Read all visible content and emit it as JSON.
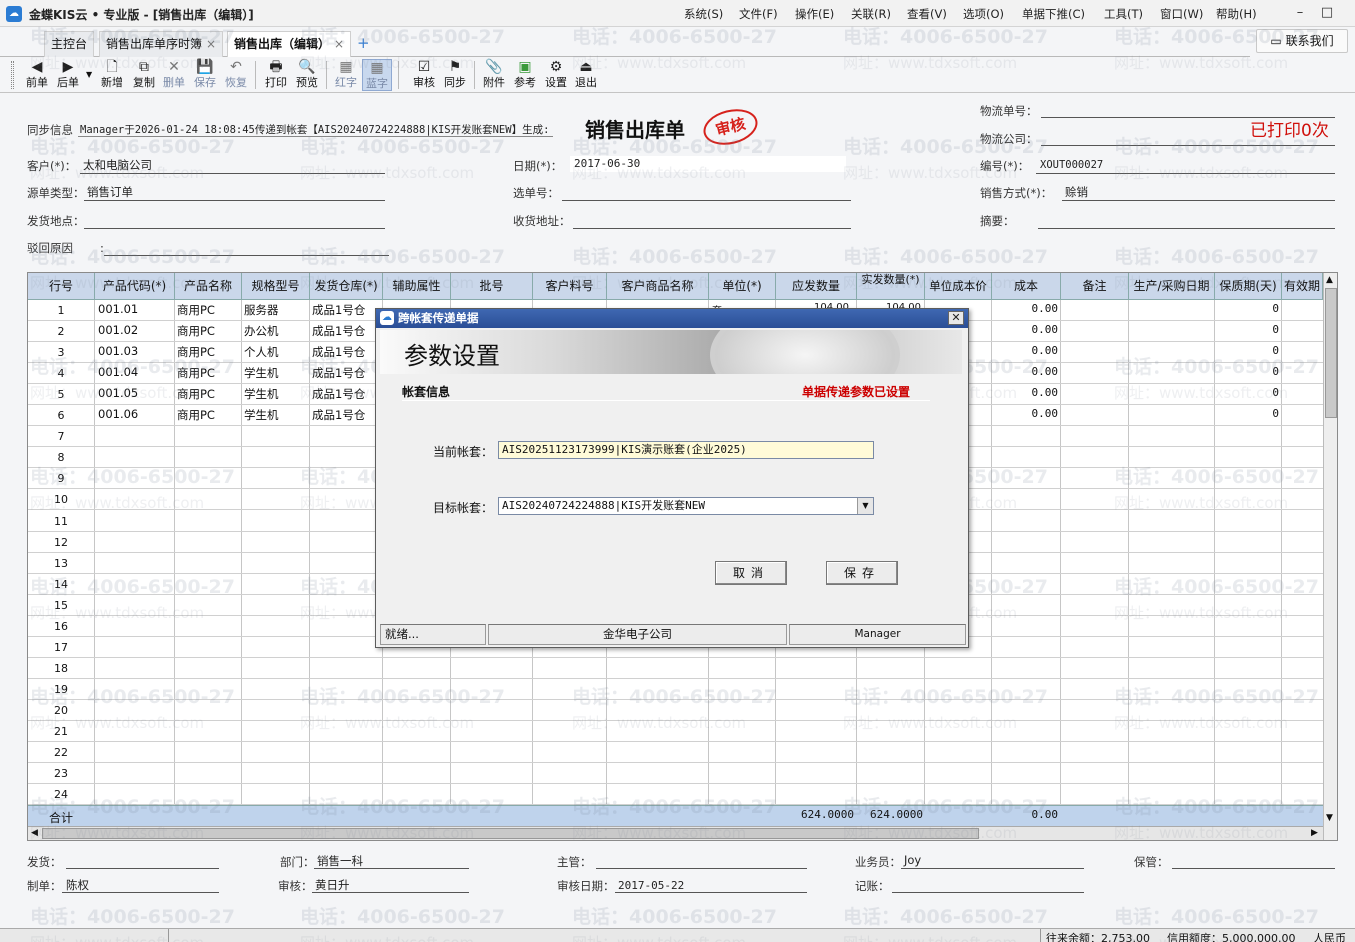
{
  "app": {
    "title": "金蝶KIS云 • 专业版 - [销售出库（编辑）]",
    "logo_color": "#2b7cd3"
  },
  "menu": [
    "系统(S)",
    "文件(F)",
    "操作(E)",
    "关联(R)",
    "查看(V)",
    "选项(O)",
    "单据下推(C)",
    "工具(T)",
    "窗口(W)",
    "帮助(H)"
  ],
  "window_controls": {
    "minimize": "–",
    "restore": "□",
    "close": "✕"
  },
  "contact_button": "联系我们",
  "tabs": {
    "home": "主控台",
    "t1": "销售出库单序时簿",
    "t2": "销售出库（编辑）",
    "add": "+",
    "close": "×"
  },
  "toolbar": {
    "prev": "前单",
    "next": "后单",
    "new": "新增",
    "copy": "复制",
    "delete": "删单",
    "save": "保存",
    "restore": "恢复",
    "print": "打印",
    "preview": "预览",
    "red": "红字",
    "blue": "蓝字",
    "audit": "审核",
    "sync": "同步",
    "attach": "附件",
    "ref": "参考",
    "settings": "设置",
    "exit": "退出"
  },
  "header": {
    "sync_info_label": "同步信息",
    "sync_info_value": "Manager于2026-01-24 18:08:45传递到帐套【AIS20240724224888|KIS开发账套NEW】生成:",
    "doc_title": "销售出库单",
    "stamp": "审核",
    "printed": "已打印0次",
    "customer_label": "客户(*)：",
    "customer": "太和电脑公司",
    "date_label": "日期(*)：",
    "date": "2017-06-30",
    "number_label": "编号(*)：",
    "number": "XOUT000027",
    "source_label": "源单类型：",
    "source": "销售订单",
    "select_label": "选单号：",
    "select": "",
    "sale_method_label": "销售方式(*)：",
    "sale_method": "赊销",
    "ship_place_label": "发货地点：",
    "ship_place": "",
    "recv_addr_label": "收货地址：",
    "recv_addr": "",
    "summary_label": "摘要：",
    "summary": "",
    "reject_label": "驳回原因",
    "reject_colon": ":",
    "reject": "",
    "logistics_no_label": "物流单号：",
    "logistics_no": "",
    "logistics_co_label": "物流公司：",
    "logistics_co": ""
  },
  "grid": {
    "columns": [
      "行号",
      "产品代码(*)",
      "产品名称",
      "规格型号",
      "发货仓库(*)",
      "辅助属性",
      "批号",
      "客户料号",
      "客户商品名称",
      "单位(*)",
      "应发数量",
      "实发数量(*)",
      "单位成本价",
      "成本",
      "备注",
      "生产/采购日期",
      "保质期(天)",
      "有效期"
    ],
    "rows": [
      {
        "no": "1",
        "code": "001.01",
        "name": "商用PC",
        "spec": "服务器",
        "wh": "成品1号仓",
        "cost": "0.00",
        "shelf": "0"
      },
      {
        "no": "2",
        "code": "001.02",
        "name": "商用PC",
        "spec": "办公机",
        "wh": "成品1号仓",
        "cost": "0.00",
        "shelf": "0"
      },
      {
        "no": "3",
        "code": "001.03",
        "name": "商用PC",
        "spec": "个人机",
        "wh": "成品1号仓",
        "cost": "0.00",
        "shelf": "0"
      },
      {
        "no": "4",
        "code": "001.04",
        "name": "商用PC",
        "spec": "学生机",
        "wh": "成品1号仓",
        "cost": "0.00",
        "shelf": "0"
      },
      {
        "no": "5",
        "code": "001.05",
        "name": "商用PC",
        "spec": "学生机",
        "wh": "成品1号仓",
        "cost": "0.00",
        "shelf": "0"
      },
      {
        "no": "6",
        "code": "001.06",
        "name": "商用PC",
        "spec": "学生机",
        "wh": "成品1号仓",
        "cost": "0.00",
        "shelf": "0"
      }
    ],
    "empty_rows": [
      "7",
      "8",
      "9",
      "10",
      "11",
      "12",
      "13",
      "14",
      "15",
      "16",
      "17",
      "18",
      "19",
      "20",
      "21",
      "22",
      "23",
      "24"
    ],
    "total_label": "合计",
    "total_due": "624.0000",
    "total_actual": "624.0000",
    "total_cost": "0.00",
    "row1_unit_partial": "套",
    "row1_due_partial": "104.00",
    "row1_actual_partial": "104.00"
  },
  "footer": {
    "ship_label": "发货：",
    "ship": "",
    "dept_label": "部门：",
    "dept": "销售一科",
    "manager_label": "主管：",
    "manager": "",
    "salesman_label": "业务员：",
    "salesman": "Joy",
    "keeper_label": "保管：",
    "keeper": "",
    "maker_label": "制单：",
    "maker": "陈权",
    "auditor_label": "审核：",
    "auditor": "黄日升",
    "audit_date_label": "审核日期：",
    "audit_date": "2017-05-22",
    "booker_label": "记账：",
    "booker": ""
  },
  "bottom_status": {
    "balance": "往来余额：2,753.00",
    "credit": "信用额度：5,000,000.00",
    "currency": "人民币"
  },
  "dialog": {
    "title": "跨帐套传递单据",
    "banner": "参数设置",
    "section": "帐套信息",
    "notice": "单据传递参数已设置",
    "notice_color": "#cc0000",
    "current_label": "当前帐套：",
    "current_value": "AIS20251123173999|KIS演示账套(企业2025)",
    "target_label": "目标帐套：",
    "target_value": "AIS20240724224888|KIS开发账套NEW",
    "cancel": "取消",
    "save": "保存",
    "status_ready": "就绪...",
    "status_company": "金华电子公司",
    "status_user": "Manager"
  },
  "watermark": {
    "phone": "电话：4006-6500-27",
    "site": "网址：www.tdxsoft.com"
  }
}
